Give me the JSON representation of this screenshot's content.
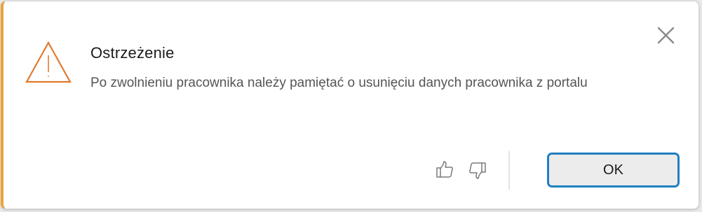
{
  "dialog": {
    "title": "Ostrzeżenie",
    "message": "Po zwolnieniu pracownika należy pamiętać o usunięciu danych pracownika z portalu",
    "icons": {
      "warning": "warning-triangle-icon",
      "close": "close-icon",
      "thumbs_up": "thumbs-up-icon",
      "thumbs_down": "thumbs-down-icon"
    },
    "ok_label": "OK"
  },
  "colors": {
    "accent_stripe": "#e8a33d",
    "warning_icon": "#e07a2e",
    "ok_border": "#1f7fc1",
    "ok_background": "#ececec"
  }
}
